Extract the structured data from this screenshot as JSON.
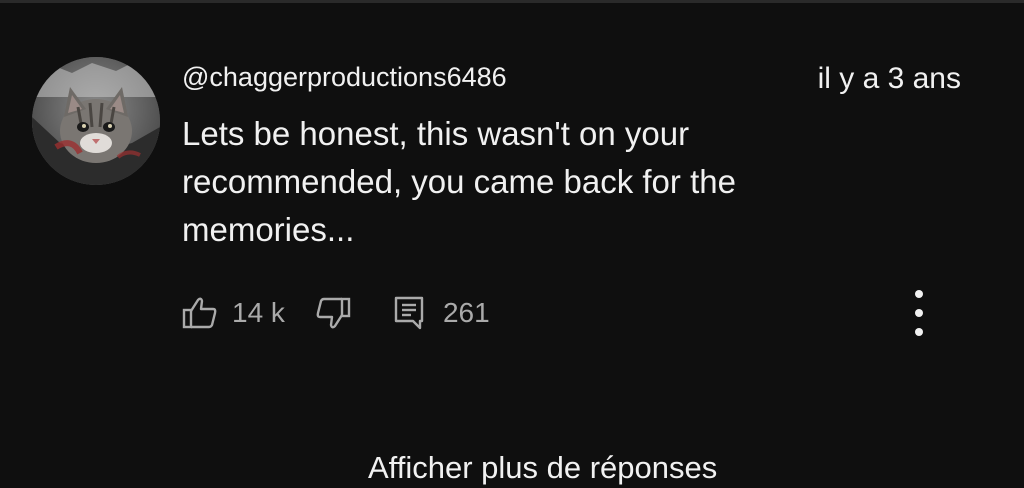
{
  "comment": {
    "author": "@chaggerproductions6486",
    "timestamp": "il y a 3 ans",
    "text": "Lets be honest, this wasn't on your recommended, you came back for the memories...",
    "avatar_icon": "cat-avatar",
    "actions": {
      "likes": "14 k",
      "like_icon": "thumbs-up-icon",
      "dislike_icon": "thumbs-down-icon",
      "replies": "261",
      "reply_icon": "comment-icon",
      "more_icon": "more-vertical-icon"
    }
  },
  "show_more_replies": "Afficher plus de réponses",
  "colors": {
    "background": "#0f0f0f",
    "text": "#f1f1f1",
    "secondary_text": "#aaaaaa"
  }
}
